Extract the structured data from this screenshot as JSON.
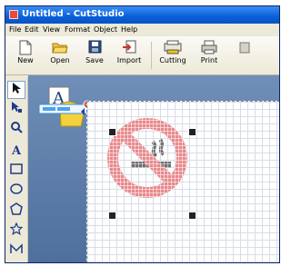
{
  "window": {
    "title": "Untitled - CutStudio"
  },
  "menu": [
    "File",
    "Edit",
    "View",
    "Format",
    "Object",
    "Help"
  ],
  "toolbar": [
    {
      "label": "New",
      "icon": "new-document-icon"
    },
    {
      "label": "Open",
      "icon": "open-folder-icon"
    },
    {
      "label": "Save",
      "icon": "save-disk-icon"
    },
    {
      "label": "Import",
      "icon": "import-icon"
    },
    {
      "label": "Cutting",
      "icon": "cutting-icon"
    },
    {
      "label": "Print",
      "icon": "print-icon"
    }
  ],
  "tools": [
    "select-arrow-icon",
    "node-edit-icon",
    "zoom-magnifier-icon",
    "text-tool-icon",
    "rectangle-tool-icon",
    "ellipse-tool-icon",
    "polygon-tool-icon",
    "star-tool-icon",
    "freehand-tool-icon"
  ],
  "colors": {
    "titlebar": "#0a5fd8",
    "no_smoking_red": "#e8898c",
    "workspace": "#5e7ea9"
  }
}
